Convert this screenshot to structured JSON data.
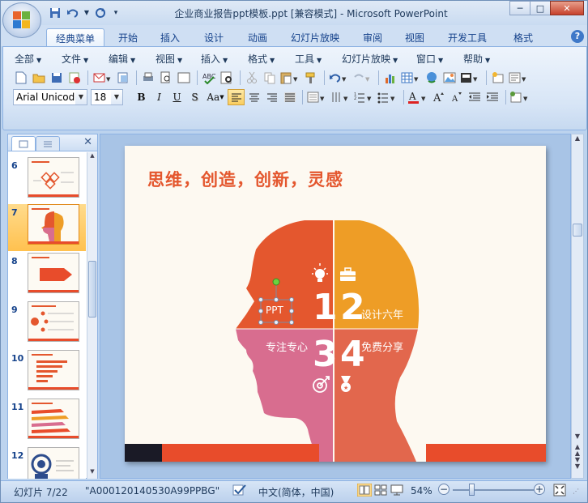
{
  "window": {
    "title": "企业商业报告ppt模板.ppt [兼容模式] - Microsoft PowerPoint",
    "minimize": "─",
    "maximize": "□",
    "close": "✕"
  },
  "tabs": [
    {
      "label": "经典菜单",
      "active": true
    },
    {
      "label": "开始"
    },
    {
      "label": "插入"
    },
    {
      "label": "设计"
    },
    {
      "label": "动画"
    },
    {
      "label": "幻灯片放映"
    },
    {
      "label": "审阅"
    },
    {
      "label": "视图"
    },
    {
      "label": "开发工具"
    },
    {
      "label": "格式"
    }
  ],
  "help": "?",
  "menus": [
    "全部",
    "文件",
    "编辑",
    "视图",
    "插入",
    "格式",
    "工具",
    "幻灯片放映",
    "窗口",
    "帮助"
  ],
  "toolbar": {
    "font_name": "Arial Unicode",
    "font_size": "18",
    "bold": "B",
    "italic": "I",
    "underline": "U",
    "shadow": "S",
    "case": "Aa"
  },
  "slides_panel": {
    "slides": [
      {
        "num": "6"
      },
      {
        "num": "7",
        "selected": true
      },
      {
        "num": "8"
      },
      {
        "num": "9"
      },
      {
        "num": "10"
      },
      {
        "num": "11"
      },
      {
        "num": "12"
      }
    ]
  },
  "slide": {
    "title": "思维，创造，创新，灵感",
    "numbers": [
      "1",
      "2",
      "3",
      "4"
    ],
    "captions": {
      "ppt_box": "PPT",
      "q2": "设计六年",
      "q3": "专注专心",
      "q4": "免费分享"
    },
    "colors": {
      "q1": "#e4572e",
      "q2": "#ee9d26",
      "q3": "#d86d8f",
      "q4": "#e2674d",
      "title": "#e4572e",
      "bottom_bar": "#e84c2b",
      "bottom_dark": "#1a1a26"
    }
  },
  "status": {
    "slide_info": "幻灯片 7/22",
    "theme": "\"A000120140530A99PPBG\"",
    "language": "中文(简体，中国)",
    "zoom": "54%",
    "zoom_minus": "−",
    "zoom_plus": "+"
  }
}
